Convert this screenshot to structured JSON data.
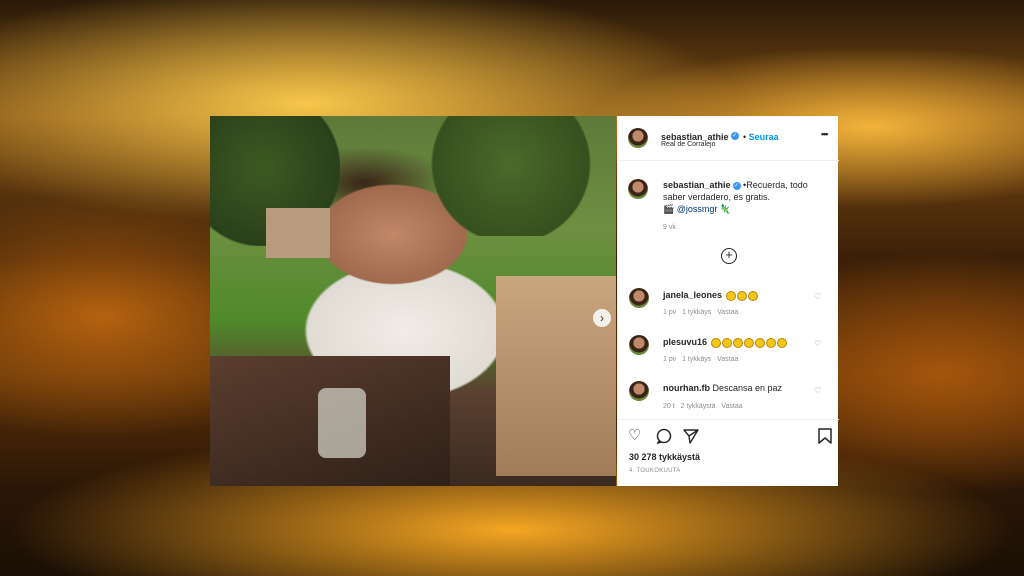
{
  "post": {
    "username": "sebastian_athie",
    "follow_label": "Seuraa",
    "location": "Real de Corralejo",
    "more_label": "•••",
    "caption_text": "•Recuerda, todo saber verdadero, es gratis.",
    "caption_tag": "@jossmgr",
    "caption_age": "9 vk",
    "likes": "30 278 tykkäystä",
    "date": "4. TOUKOKUUTA"
  },
  "comments": [
    {
      "user": "janela_leones",
      "text": "",
      "emoji_count": 3,
      "age": "1 pv",
      "likes": "1 tykkäys",
      "reply": "Vastaa"
    },
    {
      "user": "plesuvu16",
      "text": "",
      "emoji_count": 7,
      "age": "1 pv",
      "likes": "1 tykkäys",
      "reply": "Vastaa"
    },
    {
      "user": "nourhan.fb",
      "text": "Descansa en paz",
      "emoji_count": 0,
      "age": "20 t",
      "likes": "2 tykkäystä",
      "reply": "Vastaa"
    }
  ],
  "icons": {
    "load_more": "plus-circle-icon",
    "like": "heart-icon",
    "comment": "comment-icon",
    "share": "paper-plane-icon",
    "save": "bookmark-icon",
    "carousel_next": "chevron-right-icon"
  },
  "colors": {
    "accent": "#0095f6",
    "verified": "#3897f0"
  }
}
